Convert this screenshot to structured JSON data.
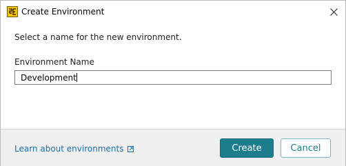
{
  "window": {
    "title": "Create Environment",
    "app_icon": "environment-app-icon",
    "close_icon": "close-icon"
  },
  "dialog": {
    "prompt": "Select a name for the new environment.",
    "field_label": "Environment Name",
    "field_value": "Development"
  },
  "footer": {
    "learn_link": "Learn about environments",
    "external_icon": "external-link-icon",
    "create_label": "Create",
    "cancel_label": "Cancel"
  },
  "colors": {
    "accent": "#1c7d8c",
    "link": "#1a6fa6",
    "footer_bg": "#f0f0f0"
  }
}
